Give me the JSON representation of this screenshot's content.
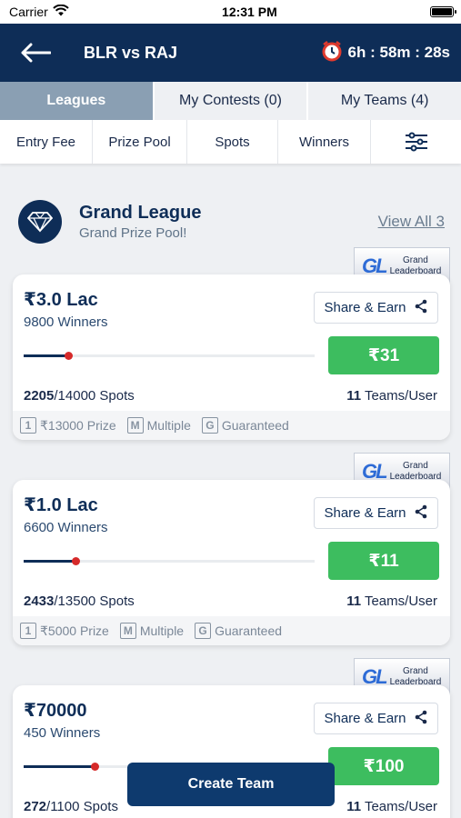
{
  "status": {
    "carrier": "Carrier",
    "time": "12:31 PM"
  },
  "header": {
    "match": "BLR vs RAJ",
    "timer": "6h : 58m : 28s"
  },
  "tabs": [
    {
      "label": "Leagues",
      "active": true
    },
    {
      "label": "My Contests (0)",
      "active": false
    },
    {
      "label": "My Teams (4)",
      "active": false
    }
  ],
  "filters": [
    "Entry Fee",
    "Prize Pool",
    "Spots",
    "Winners"
  ],
  "league": {
    "title": "Grand League",
    "subtitle": "Grand Prize Pool!",
    "view_all": "View All 3"
  },
  "banner": {
    "mark": "GL",
    "line1": "Grand",
    "line2": "Leaderboard"
  },
  "share_label": "Share & Earn",
  "teams_label": "Teams/User",
  "contests": [
    {
      "prize": "₹3.0 Lac",
      "winners": "9800 Winners",
      "fee": "₹31",
      "spots_filled": "2205",
      "spots_total": "/14000 Spots",
      "fill_fraction": 0.1575,
      "teams": "11",
      "first_prize": "₹13000 Prize",
      "entry_type": "Multiple",
      "guarantee": "Guaranteed"
    },
    {
      "prize": "₹1.0 Lac",
      "winners": "6600 Winners",
      "fee": "₹11",
      "spots_filled": "2433",
      "spots_total": "/13500 Spots",
      "fill_fraction": 0.18,
      "teams": "11",
      "first_prize": "₹5000 Prize",
      "entry_type": "Multiple",
      "guarantee": "Guaranteed"
    },
    {
      "prize": "₹70000",
      "winners": "450 Winners",
      "fee": "₹100",
      "spots_filled": "272",
      "spots_total": "/1100 Spots",
      "fill_fraction": 0.247,
      "teams": "11",
      "first_prize": "",
      "entry_type": "",
      "guarantee": ""
    }
  ],
  "create_team": "Create Team",
  "colors": {
    "navy": "#0e2d57",
    "green": "#3dbd5f",
    "progress_dot": "#d62a2a",
    "tab_active": "#8a9fb3"
  },
  "icons": [
    "wifi-icon",
    "battery-icon",
    "back-arrow-icon",
    "alarm-clock-icon",
    "filter-sliders-icon",
    "diamond-icon",
    "share-icon",
    "first-prize-icon",
    "multiple-entry-icon",
    "guaranteed-icon"
  ]
}
